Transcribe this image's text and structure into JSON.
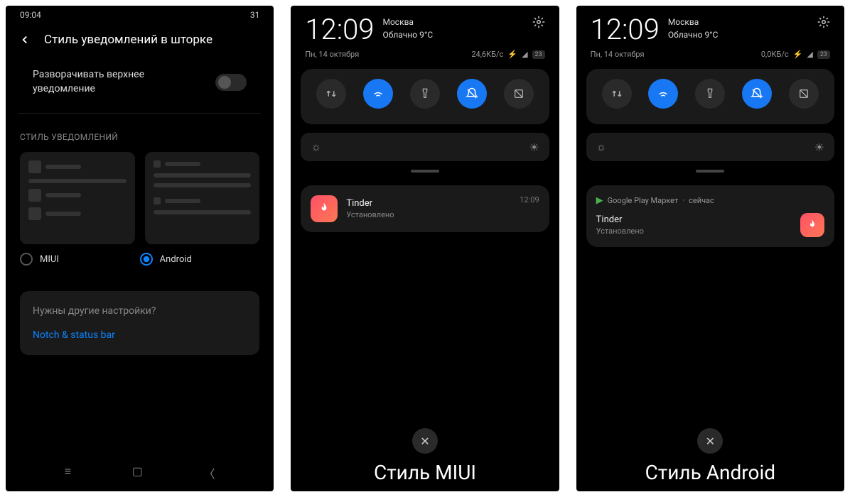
{
  "phone1": {
    "status_time": "09:04",
    "status_right": "31",
    "title": "Стиль уведомлений в шторке",
    "toggle_label": "Разворачивать верхнее уведомление",
    "section_label": "СТИЛЬ УВЕДОМЛЕНИЙ",
    "radio_miui": "MIUI",
    "radio_android": "Android",
    "more_question": "Нужны другие настройки?",
    "more_link": "Notch & status bar"
  },
  "phone2": {
    "clock": "12:09",
    "location": "Москва",
    "weather": "Облачно 9°С",
    "date": "Пн, 14 октября",
    "speed": "24,6КБ/с",
    "badge": "23",
    "notif_title": "Tinder",
    "notif_sub": "Установлено",
    "notif_time": "12:09",
    "caption": "Стиль MIUI"
  },
  "phone3": {
    "clock": "12:09",
    "location": "Москва",
    "weather": "Облачно 9°С",
    "date": "Пн, 14 октября",
    "speed": "0,0КБ/с",
    "badge": "23",
    "source": "Google Play Маркет",
    "source_time": "сейчас",
    "notif_title": "Tinder",
    "notif_sub": "Установлено",
    "caption": "Стиль Android"
  }
}
